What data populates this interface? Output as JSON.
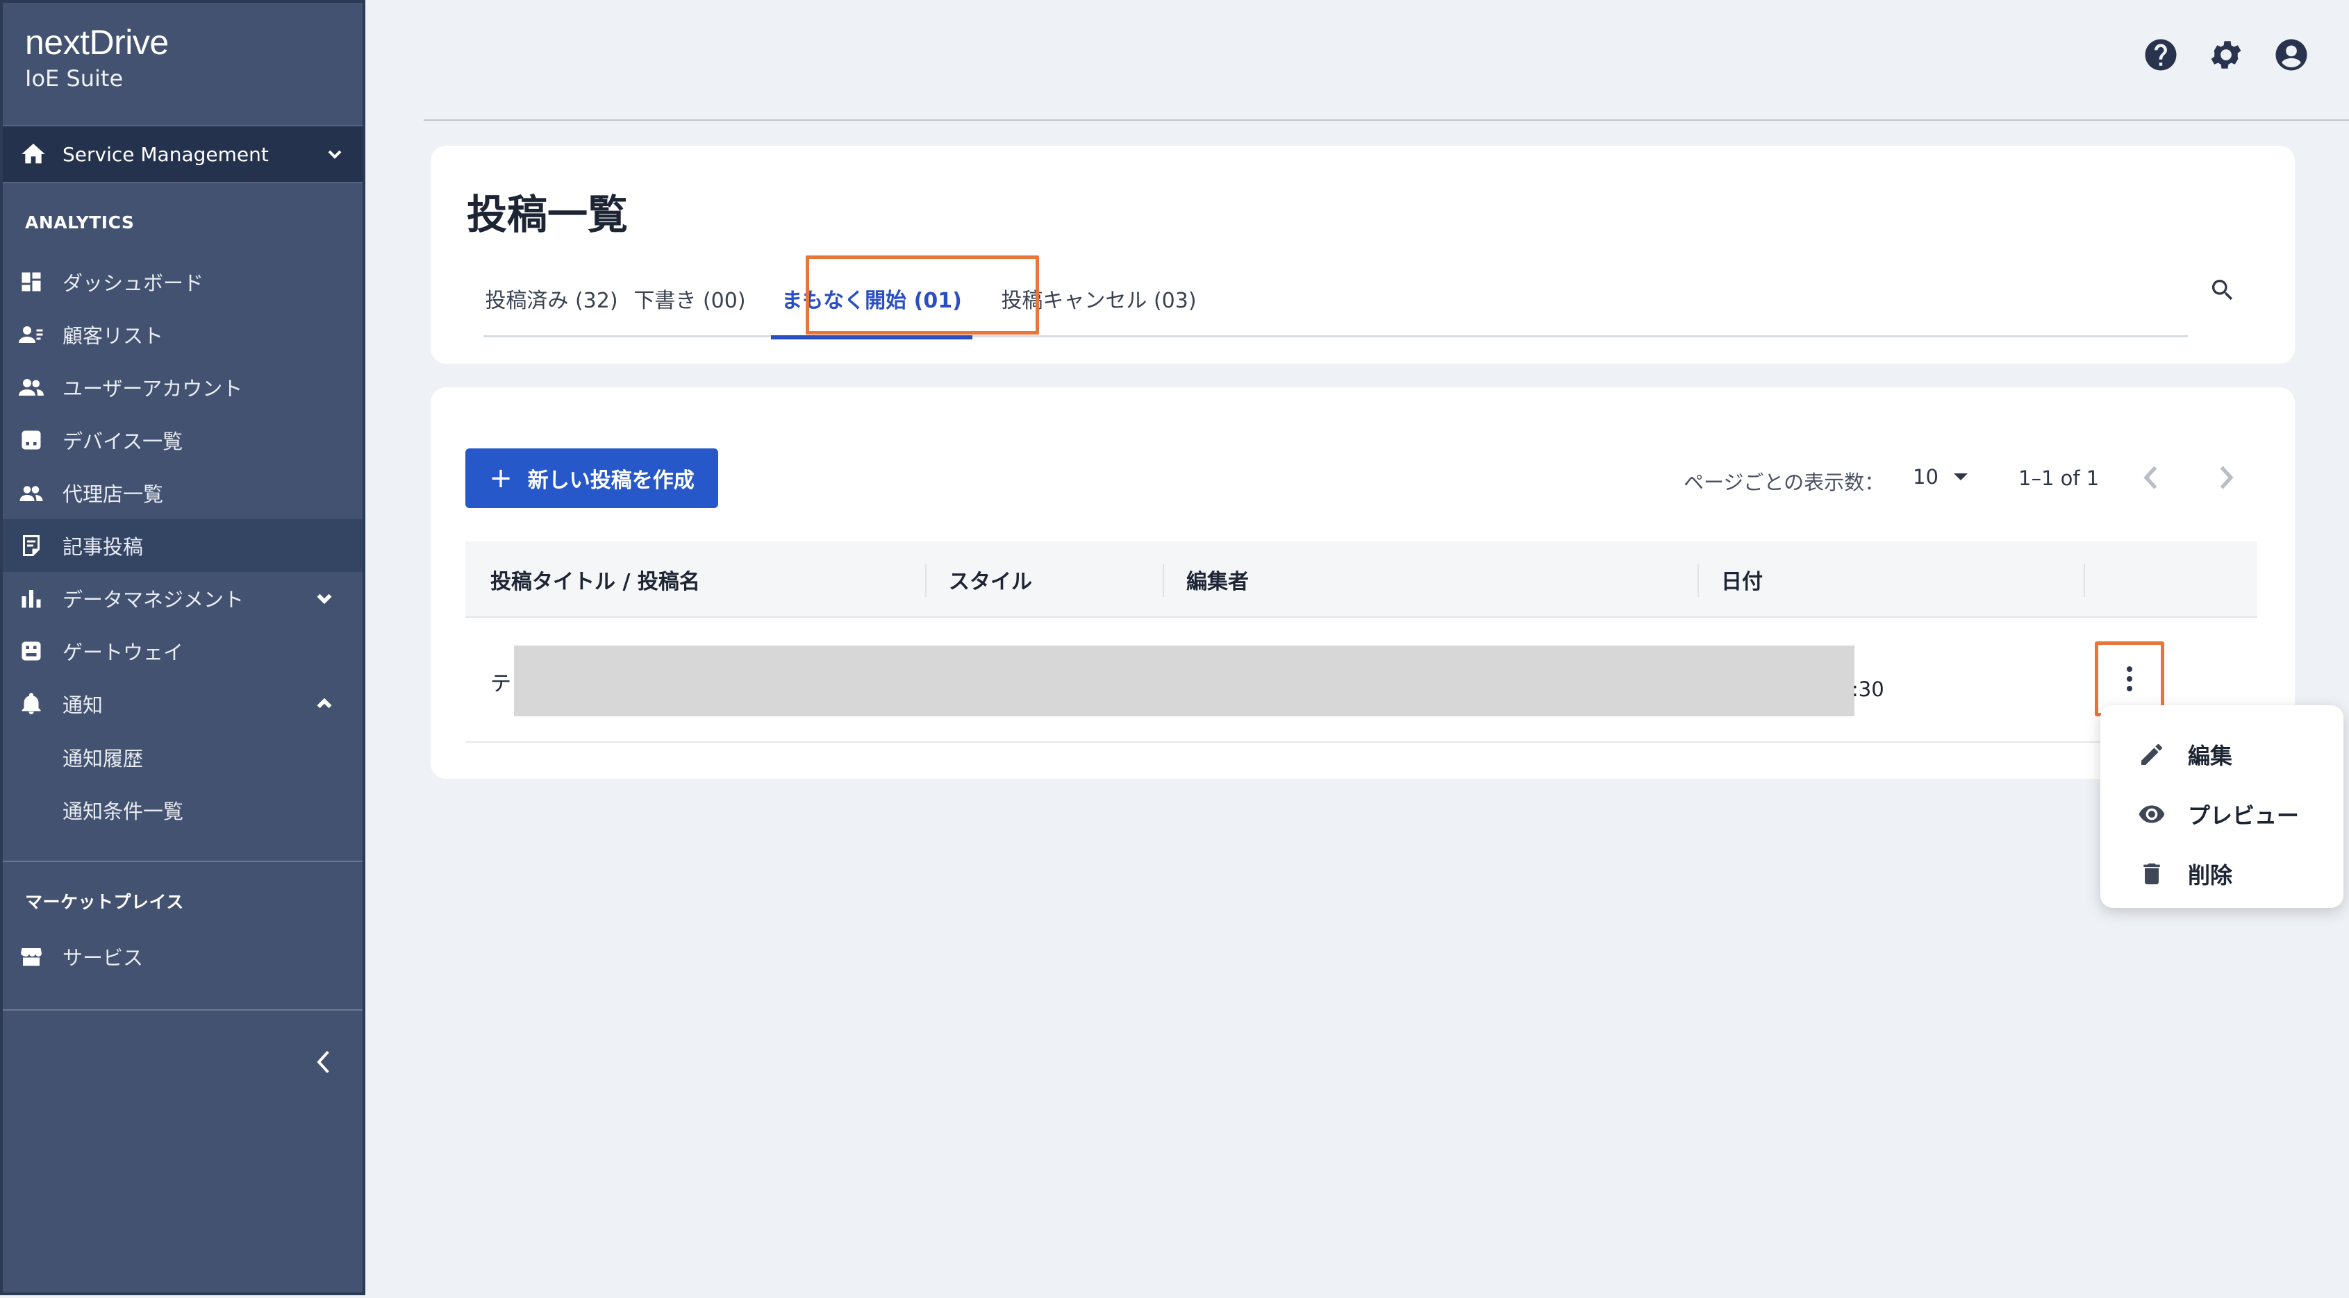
{
  "brand": {
    "logo": "nextDrive",
    "subtitle": "IoE Suite"
  },
  "sidebar": {
    "service_management": "Service Management",
    "analytics_section": "ANALYTICS",
    "items": [
      {
        "label": "ダッシュボード",
        "icon": "dashboard-icon"
      },
      {
        "label": "顧客リスト",
        "icon": "customer-list-icon"
      },
      {
        "label": "ユーザーアカウント",
        "icon": "users-icon"
      },
      {
        "label": "デバイス一覧",
        "icon": "device-icon"
      },
      {
        "label": "代理店一覧",
        "icon": "agency-icon"
      },
      {
        "label": "記事投稿",
        "icon": "article-icon",
        "active": true
      },
      {
        "label": "データマネジメント",
        "icon": "data-icon"
      },
      {
        "label": "ゲートウェイ",
        "icon": "gateway-icon"
      },
      {
        "label": "通知",
        "icon": "bell-icon"
      }
    ],
    "notification_sub": [
      "通知履歴",
      "通知条件一覧"
    ],
    "marketplace_section": "マーケットプレイス",
    "marketplace_items": [
      {
        "label": "サービス",
        "icon": "store-icon"
      }
    ]
  },
  "header": {
    "icons": [
      "help-icon",
      "settings-icon",
      "account-icon"
    ]
  },
  "page": {
    "title": "投稿一覧",
    "tabs": [
      {
        "label": "投稿済み (32)"
      },
      {
        "label": "下書き (00)"
      },
      {
        "label": "まもなく開始 (01)",
        "active": true
      },
      {
        "label": "投稿キャンセル (03)"
      }
    ]
  },
  "toolbar": {
    "new_post_label": "新しい投稿を作成",
    "rows_per_page_label": "ページごとの表示数：",
    "rows_per_page_value": "10",
    "range": "1–1 of 1"
  },
  "table": {
    "columns": [
      "投稿タイトル / 投稿名",
      "スタイル",
      "編集者",
      "日付"
    ],
    "rows": [
      {
        "title_prefix": "テ",
        "time_suffix": ":30"
      }
    ]
  },
  "row_menu": {
    "items": [
      {
        "label": "編集",
        "icon": "pencil-icon"
      },
      {
        "label": "プレビュー",
        "icon": "eye-icon"
      },
      {
        "label": "削除",
        "icon": "trash-icon"
      }
    ]
  },
  "colors": {
    "sidebar": "#435270",
    "accent": "#2658c9",
    "highlight": "#e8763a"
  }
}
